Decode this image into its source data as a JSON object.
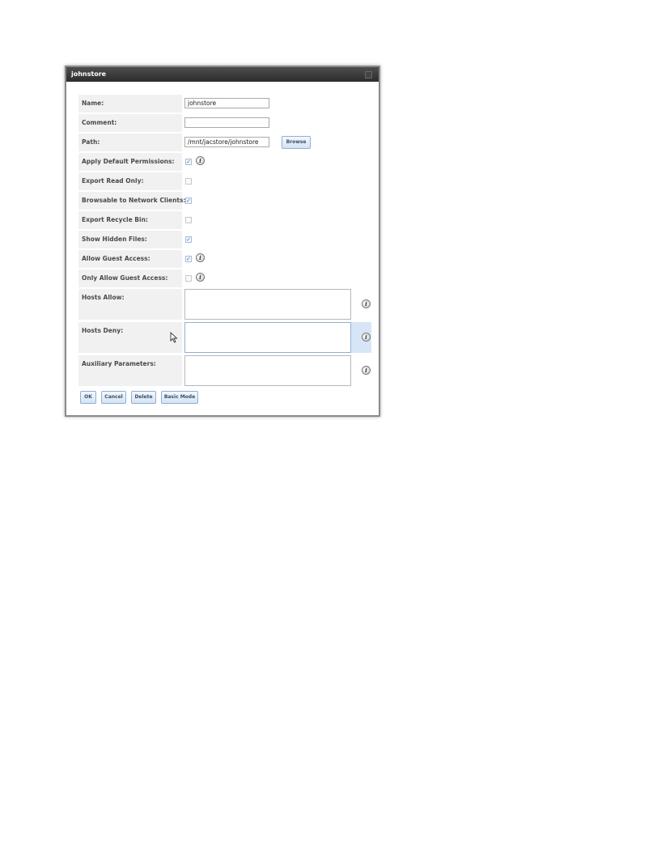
{
  "dialog": {
    "title": "johnstore"
  },
  "fields": {
    "name": {
      "label": "Name:",
      "value": "johnstore"
    },
    "comment": {
      "label": "Comment:",
      "value": ""
    },
    "path": {
      "label": "Path:",
      "value": "/mnt/jacstore/johnstore",
      "browse_label": "Browse"
    },
    "apply_default_permissions": {
      "label": "Apply Default Permissions:",
      "checked": true
    },
    "export_read_only": {
      "label": "Export Read Only:",
      "checked": false
    },
    "browsable": {
      "label": "Browsable to Network Clients:",
      "checked": true
    },
    "export_recycle_bin": {
      "label": "Export Recycle Bin:",
      "checked": false
    },
    "show_hidden_files": {
      "label": "Show Hidden Files:",
      "checked": true
    },
    "allow_guest_access": {
      "label": "Allow Guest Access:",
      "checked": true
    },
    "only_allow_guest_access": {
      "label": "Only Allow Guest Access:",
      "checked": false
    },
    "hosts_allow": {
      "label": "Hosts Allow:",
      "value": ""
    },
    "hosts_deny": {
      "label": "Hosts Deny:",
      "value": ""
    },
    "auxiliary_parameters": {
      "label": "Auxiliary Parameters:",
      "value": ""
    }
  },
  "buttons": {
    "ok": "OK",
    "cancel": "Cancel",
    "delete": "Delete",
    "basic_mode": "Basic Mode"
  },
  "icons": {
    "info": "info-icon",
    "check": "✓"
  },
  "colors": {
    "titlebar": "#333333",
    "label_bg": "#f1f1f1",
    "button_border": "#8fb0d3",
    "highlight": "#d7e6f7"
  }
}
